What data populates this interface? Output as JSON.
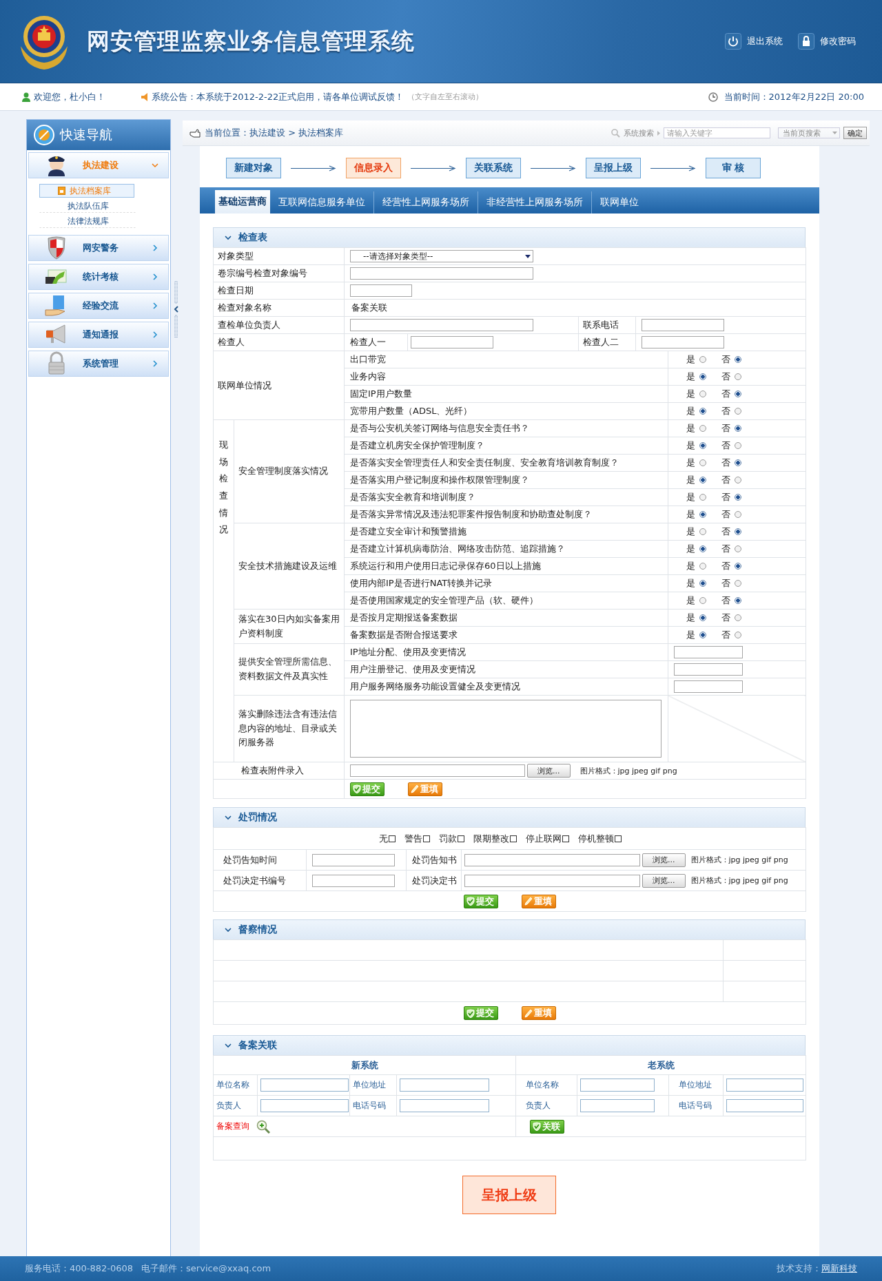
{
  "header": {
    "title": "网安管理监察业务信息管理系统",
    "actions": [
      {
        "label": "退出系统",
        "kind": "power"
      },
      {
        "label": "修改密码",
        "kind": "lock"
      }
    ]
  },
  "info_bar": {
    "welcome": "欢迎您，杜小白！",
    "notice": "系统公告：本系统于2012-2-22正式启用，请各单位调试反馈！",
    "notice_hint": "（文字自左至右滚动）",
    "time": "当前时间：2012年2月22日 20:00"
  },
  "sidebar": {
    "title": "快速导航",
    "groups": [
      {
        "label": "执法建设",
        "kind": "police",
        "expanded": true,
        "children": [
          {
            "label": "执法档案库",
            "selected": true
          },
          {
            "label": "执法队伍库",
            "selected": false
          },
          {
            "label": "法律法规库",
            "selected": false
          }
        ]
      },
      {
        "label": "网安警务",
        "kind": "shield",
        "expanded": false
      },
      {
        "label": "统计考核",
        "kind": "chart",
        "expanded": false
      },
      {
        "label": "经验交流",
        "kind": "hand",
        "expanded": false
      },
      {
        "label": "通知通报",
        "kind": "megaphone",
        "expanded": false
      },
      {
        "label": "系统管理",
        "kind": "lock",
        "expanded": false
      }
    ]
  },
  "breadcrumb": "当前位置：执法建设 > 执法档案库",
  "search": {
    "label": "系统搜索",
    "placeholder": "请输入关键字",
    "scope": "当前页搜索",
    "button": "确定"
  },
  "steps": [
    {
      "label": "新建对象",
      "selected": false
    },
    {
      "label": "信息录入",
      "selected": true
    },
    {
      "label": "关联系统",
      "selected": false
    },
    {
      "label": "呈报上级",
      "selected": false
    },
    {
      "label": "审 核",
      "selected": false
    }
  ],
  "tabs": [
    {
      "label": "基础运营商",
      "selected": true
    },
    {
      "label": "互联网信息服务单位",
      "selected": false
    },
    {
      "label": "经营性上网服务场所",
      "selected": false
    },
    {
      "label": "非经营性上网服务场所",
      "selected": false
    },
    {
      "label": "联网单位",
      "selected": false
    }
  ],
  "check_form": {
    "title": "检查表",
    "rows": [
      {
        "kind": "select",
        "label": "对象类型",
        "value": "--请选择对象类型--"
      },
      {
        "kind": "text",
        "label": "卷宗编号检查对象编号"
      },
      {
        "kind": "date",
        "label": "检查日期"
      },
      {
        "kind": "static",
        "label": "检查对象名称",
        "value": "备案关联"
      },
      {
        "kind": "pair",
        "label": "查检单位负责人",
        "label2": "联系电话"
      },
      {
        "kind": "inspectors",
        "label": "检查人",
        "sub1": "检查人一",
        "sub2": "检查人二"
      }
    ],
    "network_unit": {
      "label": "联网单位情况",
      "items": [
        {
          "text": "出口带宽",
          "options": [
            {
              "label": "是",
              "selected": false
            },
            {
              "label": "否",
              "selected": true
            }
          ]
        },
        {
          "text": "业务内容",
          "options": [
            {
              "label": "是",
              "selected": true
            },
            {
              "label": "否",
              "selected": false
            }
          ]
        },
        {
          "text": "固定IP用户数量",
          "options": [
            {
              "label": "是",
              "selected": false
            },
            {
              "label": "否",
              "selected": true
            }
          ]
        },
        {
          "text": "宽带用户数量（ADSL、光纤）",
          "options": [
            {
              "label": "是",
              "selected": true
            },
            {
              "label": "否",
              "selected": false
            }
          ]
        }
      ]
    },
    "onsite": {
      "label": "现场检查情况",
      "groups": [
        {
          "label": "安全管理制度落实情况",
          "kind": "radio",
          "items": [
            {
              "text": "是否与公安机关签订网络与信息安全责任书？",
              "options": [
                {
                  "label": "是",
                  "selected": false
                },
                {
                  "label": "否",
                  "selected": true
                }
              ]
            },
            {
              "text": "是否建立机房安全保护管理制度？",
              "options": [
                {
                  "label": "是",
                  "selected": true
                },
                {
                  "label": "否",
                  "selected": false
                }
              ]
            },
            {
              "text": "是否落实安全管理责任人和安全责任制度、安全教育培训教育制度？",
              "options": [
                {
                  "label": "是",
                  "selected": false
                },
                {
                  "label": "否",
                  "selected": true
                }
              ]
            },
            {
              "text": "是否落实用户登记制度和操作权限管理制度？",
              "options": [
                {
                  "label": "是",
                  "selected": true
                },
                {
                  "label": "否",
                  "selected": false
                }
              ]
            },
            {
              "text": "是否落实安全教育和培训制度？",
              "options": [
                {
                  "label": "是",
                  "selected": false
                },
                {
                  "label": "否",
                  "selected": true
                }
              ]
            },
            {
              "text": "是否落实异常情况及违法犯罪案件报告制度和协助查处制度？",
              "options": [
                {
                  "label": "是",
                  "selected": true
                },
                {
                  "label": "否",
                  "selected": false
                }
              ]
            }
          ]
        },
        {
          "label": "安全技术措施建设及运维",
          "kind": "radio",
          "items": [
            {
              "text": "是否建立安全审计和预警措施",
              "options": [
                {
                  "label": "是",
                  "selected": false
                },
                {
                  "label": "否",
                  "selected": true
                }
              ]
            },
            {
              "text": "是否建立计算机病毒防治、网络攻击防范、追踪措施？",
              "options": [
                {
                  "label": "是",
                  "selected": true
                },
                {
                  "label": "否",
                  "selected": false
                }
              ]
            },
            {
              "text": "系统运行和用户使用日志记录保存60日以上措施",
              "options": [
                {
                  "label": "是",
                  "selected": false
                },
                {
                  "label": "否",
                  "selected": true
                }
              ]
            },
            {
              "text": "使用内部IP是否进行NAT转换并记录",
              "options": [
                {
                  "label": "是",
                  "selected": true
                },
                {
                  "label": "否",
                  "selected": false
                }
              ]
            },
            {
              "text": "是否使用国家规定的安全管理产品（软、硬件）",
              "options": [
                {
                  "label": "是",
                  "selected": false
                },
                {
                  "label": "否",
                  "selected": true
                }
              ]
            }
          ]
        },
        {
          "label": "落实在30日内如实备案用户资料制度",
          "kind": "radio",
          "items": [
            {
              "text": "是否按月定期报送备案数据",
              "options": [
                {
                  "label": "是",
                  "selected": true
                },
                {
                  "label": "否",
                  "selected": false
                }
              ]
            },
            {
              "text": "备案数据是否附合报送要求",
              "options": [
                {
                  "label": "是",
                  "selected": true
                },
                {
                  "label": "否",
                  "selected": false
                }
              ]
            }
          ]
        },
        {
          "label": "提供安全管理所需信息、资料数据文件及真实性",
          "kind": "input",
          "items": [
            {
              "text": "IP地址分配、使用及变更情况"
            },
            {
              "text": "用户注册登记、使用及变更情况"
            },
            {
              "text": "用户服务网络服务功能设置健全及变更情况"
            }
          ]
        },
        {
          "label": "落实删除违法含有违法信息内容的地址、目录或关闭服务器",
          "kind": "textarea"
        }
      ]
    },
    "attachment": {
      "label": "检查表附件录入",
      "browse": "浏览...",
      "formats": "图片格式：jpg jpeg gif png"
    },
    "buttons": [
      {
        "label": "提交",
        "kind": "submit"
      },
      {
        "label": "重填",
        "kind": "reset"
      }
    ]
  },
  "penalty": {
    "title": "处罚情况",
    "options": [
      {
        "label": "无",
        "checked": false
      },
      {
        "label": "警告",
        "checked": false
      },
      {
        "label": "罚款",
        "checked": false
      },
      {
        "label": "限期整改",
        "checked": false
      },
      {
        "label": "停止联网",
        "checked": false
      },
      {
        "label": "停机整顿",
        "checked": false
      }
    ],
    "rows": [
      {
        "label": "处罚告知时间",
        "label2": "处罚告知书",
        "browse": "浏览...",
        "formats": "图片格式：jpg jpeg gif png"
      },
      {
        "label": "处罚决定书编号",
        "label2": "处罚决定书",
        "browse": "浏览...",
        "formats": "图片格式：jpg jpeg gif png"
      }
    ],
    "buttons": [
      {
        "label": "提交",
        "kind": "submit"
      },
      {
        "label": "重填",
        "kind": "reset"
      }
    ]
  },
  "supervision": {
    "title": "督察情况",
    "buttons": [
      {
        "label": "提交",
        "kind": "submit"
      },
      {
        "label": "重填",
        "kind": "reset"
      }
    ]
  },
  "filing": {
    "title": "备案关联",
    "systems": [
      {
        "title": "新系统",
        "fields": [
          "单位名称",
          "单位地址",
          "负责人",
          "电话号码"
        ]
      },
      {
        "title": "老系统",
        "fields": [
          "单位名称",
          "单位地址",
          "负责人",
          "电话号码"
        ]
      }
    ],
    "query_link": "备案查询",
    "link_button": "关联"
  },
  "report_button": "呈报上级",
  "footer": {
    "phone": "服务电话：400-882-0608",
    "email": "电子邮件：service@xxaq.com",
    "support_label": "技术支持：",
    "support_link": "网新科技"
  }
}
